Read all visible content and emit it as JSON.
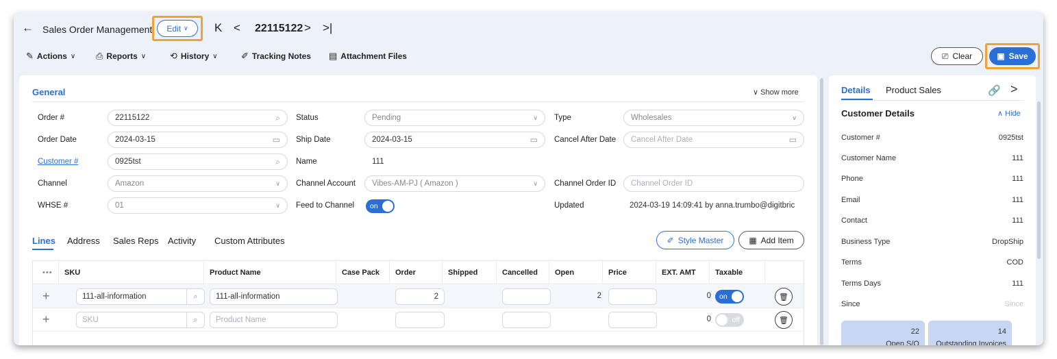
{
  "header": {
    "back_icon": "←",
    "title": "Sales Order Management",
    "edit_label": "Edit",
    "order_number": "22115122"
  },
  "toolbar": {
    "actions": "Actions",
    "reports": "Reports",
    "history": "History",
    "tracking_notes": "Tracking Notes",
    "attachment_files": "Attachment Files",
    "clear": "Clear",
    "save": "Save"
  },
  "general": {
    "title": "General",
    "show_more": "Show more",
    "labels": {
      "order": "Order #",
      "order_date": "Order Date",
      "customer": "Customer #",
      "channel": "Channel",
      "whse": "WHSE #",
      "status": "Status",
      "ship_date": "Ship Date",
      "name": "Name",
      "channel_account": "Channel Account",
      "feed_to_channel": "Feed to Channel",
      "type": "Type",
      "cancel_after_date": "Cancel After Date",
      "channel_order_id": "Channel Order ID",
      "updated": "Updated"
    },
    "values": {
      "order": "22115122",
      "order_date": "2024-03-15",
      "customer": "0925tst",
      "channel": "Amazon",
      "whse": "01",
      "status": "Pending",
      "ship_date": "2024-03-15",
      "name": "111",
      "channel_account": "Vibes-AM-PJ ( Amazon )",
      "feed_to_channel": "on",
      "type": "Wholesales",
      "updated": "2024-03-19 14:09:41 by anna.trumbo@digitbric"
    },
    "placeholders": {
      "cancel_after_date": "Cancel After Date",
      "channel_order_id": "Channel Order ID"
    }
  },
  "tabs": [
    "Lines",
    "Address",
    "Sales Reps",
    "Activity",
    "Custom Attributes"
  ],
  "lines_actions": {
    "style_master": "Style Master",
    "add_item": "Add Item"
  },
  "grid": {
    "columns": [
      "SKU",
      "Product Name",
      "Case Pack",
      "Order",
      "Shipped",
      "Cancelled",
      "Open",
      "Price",
      "EXT. AMT",
      "Taxable"
    ],
    "rows": [
      {
        "sku": "111-all-information",
        "product_name": "111-all-information",
        "order": "2",
        "open": "2",
        "ext_amt": "0",
        "taxable": "on"
      },
      {
        "sku_placeholder": "SKU",
        "product_placeholder": "Product Name",
        "ext_amt": "0",
        "taxable": "off"
      }
    ]
  },
  "side": {
    "tabs": [
      "Details",
      "Product Sales"
    ],
    "customer_details_title": "Customer Details",
    "hide": "Hide",
    "fields": [
      {
        "label": "Customer #",
        "value": "0925tst"
      },
      {
        "label": "Customer Name",
        "value": "111"
      },
      {
        "label": "Phone",
        "value": "111"
      },
      {
        "label": "Email",
        "value": "111"
      },
      {
        "label": "Contact",
        "value": "111"
      },
      {
        "label": "Business Type",
        "value": "DropShip"
      },
      {
        "label": "Terms",
        "value": "COD"
      },
      {
        "label": "Terms Days",
        "value": "111"
      },
      {
        "label": "Since",
        "value": "Since"
      }
    ],
    "stats": [
      {
        "value": "22",
        "label": "Open S/O"
      },
      {
        "value": "14",
        "label": "Outstanding Invoices"
      }
    ]
  },
  "colors": {
    "accent": "#2a6fd6",
    "highlight": "#f0a334",
    "background": "#edf2fa"
  }
}
